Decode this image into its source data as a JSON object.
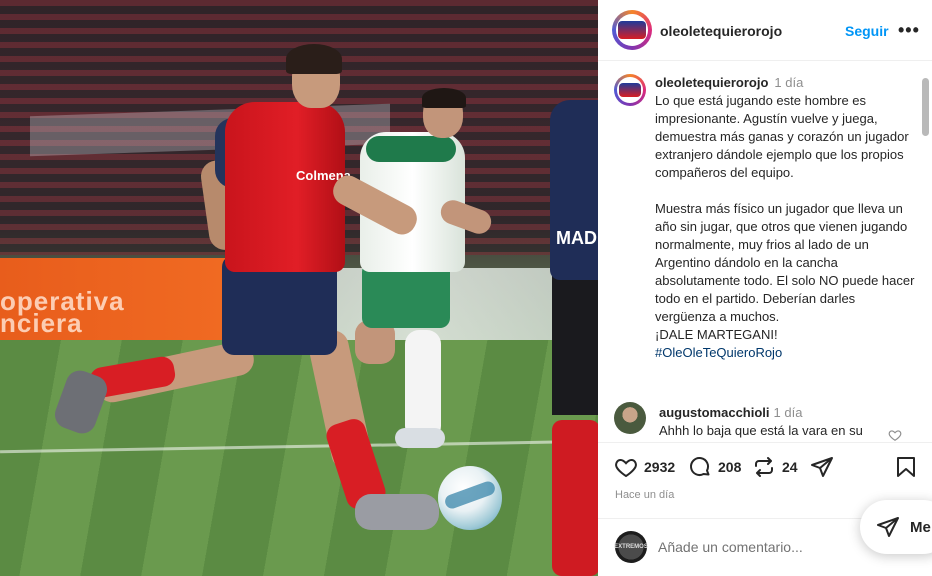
{
  "photo": {
    "board_text_line1": "operativa",
    "board_text_line2": "nciera",
    "jersey_text": "Colmena",
    "jersey_text_2": "MAD"
  },
  "post": {
    "username": "oleoletequierorojo",
    "follow_label": "Seguir",
    "more_label": "•••",
    "caption": {
      "username": "oleoletequierorojo",
      "time": "1 día",
      "text": "Lo que está jugando este hombre es impresionante. Agustín vuelve y juega, demuestra más ganas y corazón un jugador extranjero dándole ejemplo que los propios compañeros del equipo.\n\nMuestra más físico un jugador que lleva un año sin jugar, que otros que vienen jugando normalmente, muy frios al lado de un Argentino dándolo en la cancha absolutamente todo. El solo NO puede hacer todo en el partido. Deberían darles vergüenza a muchos.\n ¡DALE MARTEGANI!",
      "hashtag": "#OleOleTeQuieroRojo"
    },
    "comment": {
      "username": "augustomacchioli",
      "time": "1 día",
      "text": "Ahhh lo baja que está la vara en su"
    },
    "actions": {
      "likes": "2932",
      "comments": "208",
      "reposts": "24"
    },
    "posted_when": "Hace un día",
    "add_comment_placeholder": "Añade un comentario...",
    "commenter_avatar_text": "EXTREMOS",
    "messages_label": "Me"
  },
  "colors": {
    "link_blue": "#0095f6",
    "hashtag_blue": "#00376b",
    "muted": "#8e8e8e"
  },
  "icons": [
    "heart-icon",
    "comment-icon",
    "repost-icon",
    "share-icon",
    "bookmark-icon",
    "send-icon"
  ]
}
